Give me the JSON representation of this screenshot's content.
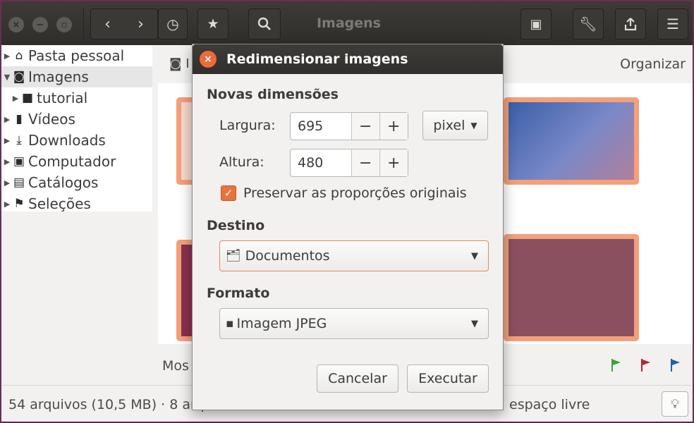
{
  "window": {
    "title": "Imagens",
    "header_buttons": [
      "back",
      "forward",
      "history",
      "bookmark",
      "search",
      "slideshow",
      "preferences",
      "share",
      "menu"
    ]
  },
  "sidebar": {
    "items": [
      {
        "label": "Pasta pessoal",
        "icon": "home-icon"
      },
      {
        "label": "Imagens",
        "icon": "camera-icon"
      },
      {
        "label": "tutorial",
        "icon": "folder-icon"
      },
      {
        "label": "Vídeos",
        "icon": "video-icon"
      },
      {
        "label": "Downloads",
        "icon": "download-icon"
      },
      {
        "label": "Computador",
        "icon": "computer-icon"
      },
      {
        "label": "Catálogos",
        "icon": "catalog-icon"
      },
      {
        "label": "Seleções",
        "icon": "flag-icon"
      }
    ]
  },
  "main": {
    "toolbar_label_partial": "I",
    "organize_label": "Organizar",
    "show_label_partial": "Mos"
  },
  "status": {
    "text": "54 arquivos (10,5 MB)  ·  8 arq",
    "text_end": "espaço livre"
  },
  "dialog": {
    "title": "Redimensionar imagens",
    "new_dimensions_label": "Novas dimensões",
    "width_label": "Largura:",
    "width_value": "695",
    "height_label": "Altura:",
    "height_value": "480",
    "minus": "−",
    "plus": "+",
    "unit_value": "pixel",
    "preserve_label": "Preservar as proporções originais",
    "preserve_checked": true,
    "destination_label": "Destino",
    "destination_value": "Documentos",
    "format_label": "Formato",
    "format_value": "Imagem JPEG",
    "cancel_label": "Cancelar",
    "execute_label": "Executar"
  },
  "colors": {
    "accent": "#e7733f",
    "titlebar": "#3c3b37",
    "thumb_border": "#f4a07a",
    "flag_green": "#3aa53a",
    "flag_red": "#b8242a",
    "flag_blue": "#1f5fb0"
  }
}
